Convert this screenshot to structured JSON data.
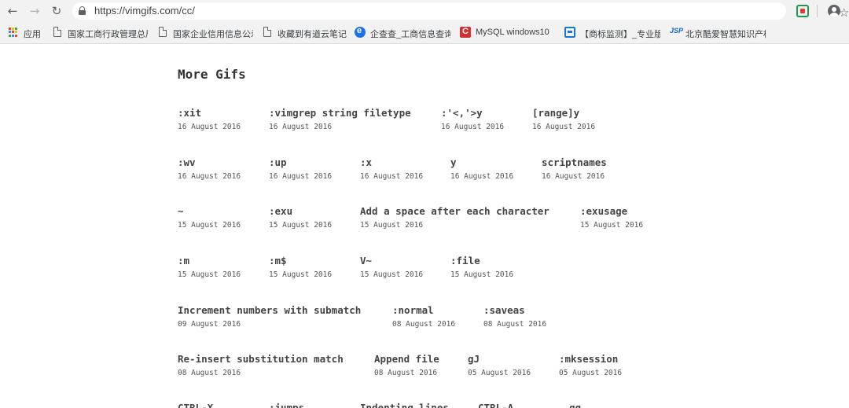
{
  "browser": {
    "url": "https://vimgifs.com/cc/",
    "back_glyph": "←",
    "forward_glyph": "→",
    "reload_glyph": "↻",
    "star_glyph": "☆"
  },
  "bookmarks": [
    {
      "label": "应用",
      "icon": "apps-grid-icon"
    },
    {
      "label": "国家工商行政管理总局",
      "icon": "page-icon"
    },
    {
      "label": "国家企业信用信息公示",
      "icon": "page-icon"
    },
    {
      "label": "收藏到有道云笔记",
      "icon": "page-icon"
    },
    {
      "label": "企查查_工商信息查询",
      "icon": "qichacha-icon"
    },
    {
      "label": "MySQL windows10",
      "icon": "mysql-icon"
    },
    {
      "label": "【商标监测】_专业版",
      "icon": "trademark-icon"
    },
    {
      "label": "北京酷爱智慧知识产权",
      "icon": "jsp-icon"
    }
  ],
  "page": {
    "heading": "More Gifs",
    "rows": [
      {
        "posts": [
          {
            "title": ":xit",
            "date": "16 August 2016"
          },
          {
            "title": ":vimgrep string filetype",
            "date": "16 August 2016"
          },
          {
            "title": ":'<,'>y",
            "date": "16 August 2016"
          },
          {
            "title": "[range]y",
            "date": "16 August 2016"
          }
        ]
      },
      {
        "posts": [
          {
            "title": ":wv",
            "date": "16 August 2016"
          },
          {
            "title": ":up",
            "date": "16 August 2016"
          },
          {
            "title": ":x",
            "date": "16 August 2016"
          },
          {
            "title": "y",
            "date": "16 August 2016"
          },
          {
            "title": "scriptnames",
            "date": "16 August 2016"
          }
        ]
      },
      {
        "posts": [
          {
            "title": "~",
            "date": "15 August 2016"
          },
          {
            "title": ":exu",
            "date": "15 August 2016"
          },
          {
            "title": "Add a space after each character",
            "date": "15 August 2016"
          },
          {
            "title": ":exusage",
            "date": "15 August 2016"
          }
        ]
      },
      {
        "posts": [
          {
            "title": ":m",
            "date": "15 August 2016"
          },
          {
            "title": ":m$",
            "date": "15 August 2016"
          },
          {
            "title": "V~",
            "date": "15 August 2016"
          },
          {
            "title": ":file",
            "date": "15 August 2016"
          }
        ]
      },
      {
        "posts": [
          {
            "title": "Increment numbers with submatch",
            "date": "09 August 2016"
          },
          {
            "title": ":normal",
            "date": "08 August 2016"
          },
          {
            "title": ":saveas",
            "date": "08 August 2016"
          }
        ]
      },
      {
        "posts": [
          {
            "title": "Re-insert substitution match",
            "date": "08 August 2016"
          },
          {
            "title": "Append file",
            "date": "08 August 2016"
          },
          {
            "title": "gJ",
            "date": "05 August 2016"
          },
          {
            "title": ":mksession",
            "date": "05 August 2016"
          }
        ]
      },
      {
        "posts": [
          {
            "title": "CTRL-X",
            "date": ""
          },
          {
            "title": ":jumps",
            "date": ""
          },
          {
            "title": "Indenting lines",
            "date": ""
          },
          {
            "title": "CTRL-A",
            "date": ""
          },
          {
            "title": "gg",
            "date": ""
          }
        ]
      }
    ]
  }
}
